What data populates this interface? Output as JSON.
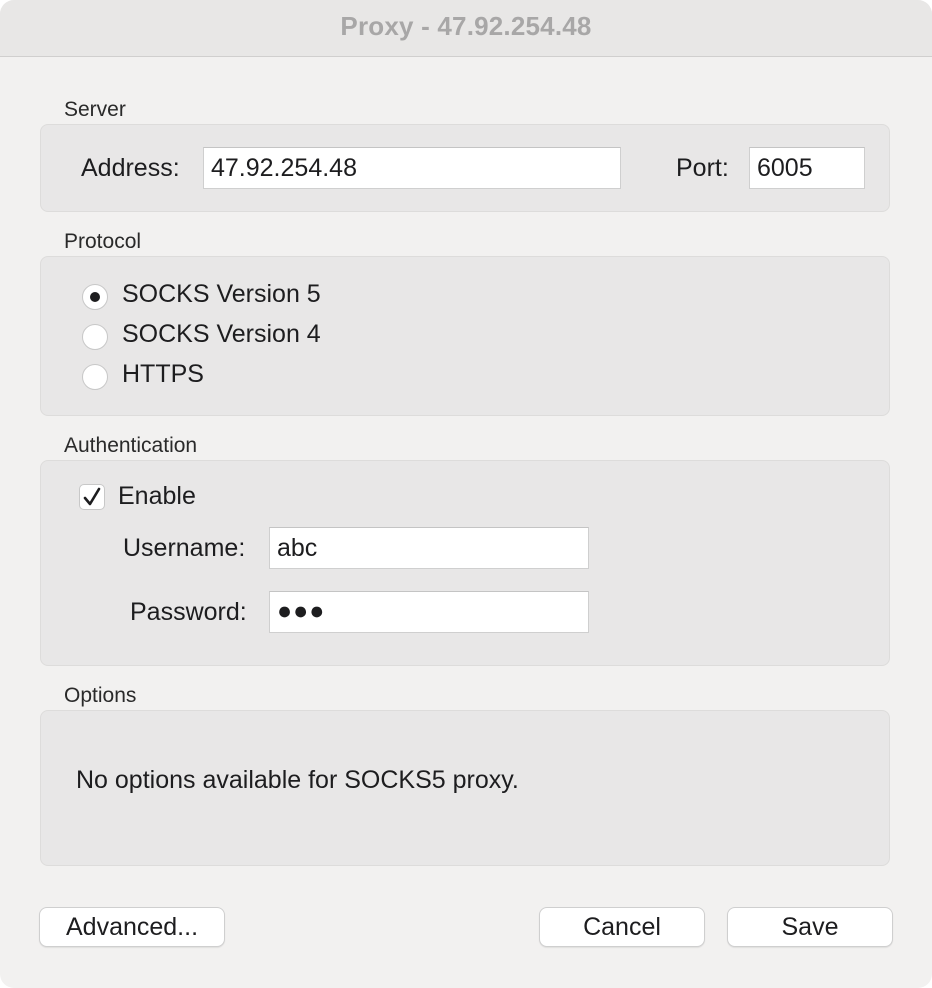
{
  "window": {
    "title": "Proxy - 47.92.254.48"
  },
  "server": {
    "section_label": "Server",
    "address_label": "Address:",
    "address_value": "47.92.254.48",
    "port_label": "Port:",
    "port_value": "6005"
  },
  "protocol": {
    "section_label": "Protocol",
    "options": [
      {
        "label": "SOCKS Version 5",
        "selected": true
      },
      {
        "label": "SOCKS Version 4",
        "selected": false
      },
      {
        "label": "HTTPS",
        "selected": false
      }
    ]
  },
  "authentication": {
    "section_label": "Authentication",
    "enable_label": "Enable",
    "enable_checked": true,
    "username_label": "Username:",
    "username_value": "abc",
    "password_label": "Password:",
    "password_value": "●●●"
  },
  "options": {
    "section_label": "Options",
    "message": "No options available for SOCKS5 proxy."
  },
  "buttons": {
    "advanced": "Advanced...",
    "cancel": "Cancel",
    "save": "Save"
  }
}
